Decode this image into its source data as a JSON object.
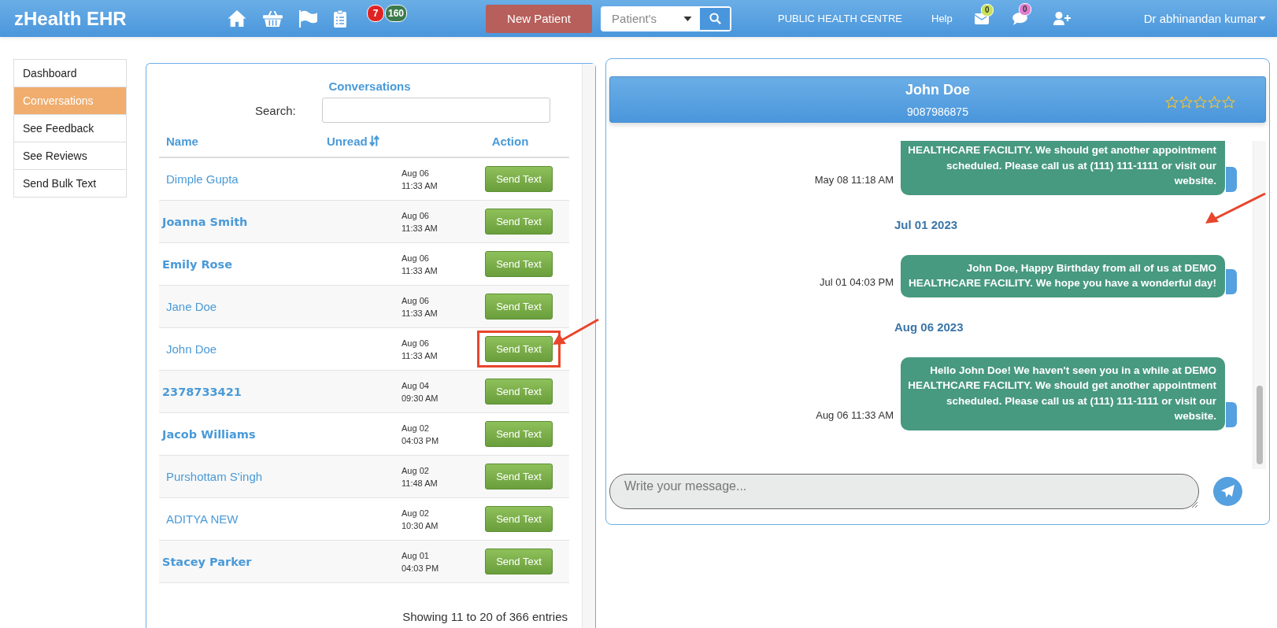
{
  "app": {
    "title": "zHealth EHR",
    "badges": [
      {
        "count": "7",
        "color": "#e02424"
      },
      {
        "count": "160",
        "color": "#3d7a4c"
      }
    ],
    "new_patient": "New Patient",
    "patient_search": {
      "value": "Patient's"
    },
    "facility": "PUBLIC HEALTH CENTRE",
    "help": "Help",
    "mail_count": "0",
    "chat_count": "0",
    "user": "Dr abhinandan kumar"
  },
  "sidebar": {
    "items": [
      {
        "label": "Dashboard",
        "selected": false
      },
      {
        "label": "Conversations",
        "selected": true
      },
      {
        "label": "See Feedback",
        "selected": false
      },
      {
        "label": "See Reviews",
        "selected": false
      },
      {
        "label": "Send Bulk Text",
        "selected": false
      }
    ]
  },
  "conversations": {
    "title": "Conversations",
    "search_label": "Search:",
    "columns": [
      "Name",
      "Unread",
      "Action"
    ],
    "rows": [
      {
        "name": "Dimple Gupta",
        "bold": false,
        "date": "Aug 06",
        "time": "11:33 AM",
        "action": "Send Text",
        "highlighted": false
      },
      {
        "name": "Joanna Smith",
        "bold": true,
        "date": "Aug 06",
        "time": "11:33 AM",
        "action": "Send Text",
        "highlighted": false
      },
      {
        "name": "Emily Rose",
        "bold": true,
        "date": "Aug 06",
        "time": "11:33 AM",
        "action": "Send Text",
        "highlighted": false
      },
      {
        "name": "Jane Doe",
        "bold": false,
        "date": "Aug 06",
        "time": "11:33 AM",
        "action": "Send Text",
        "highlighted": false
      },
      {
        "name": "John Doe",
        "bold": false,
        "date": "Aug 06",
        "time": "11:33 AM",
        "action": "Send Text",
        "highlighted": true
      },
      {
        "name": "2378733421",
        "bold": true,
        "date": "Aug 04",
        "time": "09:30 AM",
        "action": "Send Text",
        "highlighted": false
      },
      {
        "name": "Jacob Williams",
        "bold": true,
        "date": "Aug 02",
        "time": "04:03 PM",
        "action": "Send Text",
        "highlighted": false
      },
      {
        "name": "Purshottam S'ingh",
        "bold": false,
        "date": "Aug 02",
        "time": "11:48 AM",
        "action": "Send Text",
        "highlighted": false
      },
      {
        "name": "ADITYA NEW",
        "bold": false,
        "date": "Aug 02",
        "time": "10:30 AM",
        "action": "Send Text",
        "highlighted": false
      },
      {
        "name": "Stacey Parker",
        "bold": true,
        "date": "Aug 01",
        "time": "04:03 PM",
        "action": "Send Text",
        "highlighted": false
      }
    ],
    "footer": "Showing 11 to 20 of 366 entries"
  },
  "chat": {
    "name": "John Doe",
    "phone": "9087986875",
    "stars": 0,
    "items": [
      {
        "kind": "message",
        "time": "May 08 11:18 AM",
        "text": "HEALTHCARE FACILITY. We should get another appointment scheduled. Please call us at (111) 111-1111 or visit our website.",
        "annotated": false
      },
      {
        "kind": "date",
        "text": "Jul 01 2023",
        "annotated": true
      },
      {
        "kind": "message",
        "time": "Jul 01 04:03 PM",
        "text": "John Doe, Happy Birthday from all of us at DEMO HEALTHCARE FACILITY. We hope you have a wonderful day!",
        "annotated": false
      },
      {
        "kind": "date",
        "text": "Aug 06 2023",
        "annotated": false
      },
      {
        "kind": "message",
        "time": "Aug 06 11:33 AM",
        "text": "Hello John Doe! We haven't seen you in a while at DEMO HEALTHCARE FACILITY. We should get another appointment scheduled. Please call us at (111) 111-1111 or visit our website.",
        "annotated": false
      }
    ],
    "placeholder": "Write your message..."
  }
}
